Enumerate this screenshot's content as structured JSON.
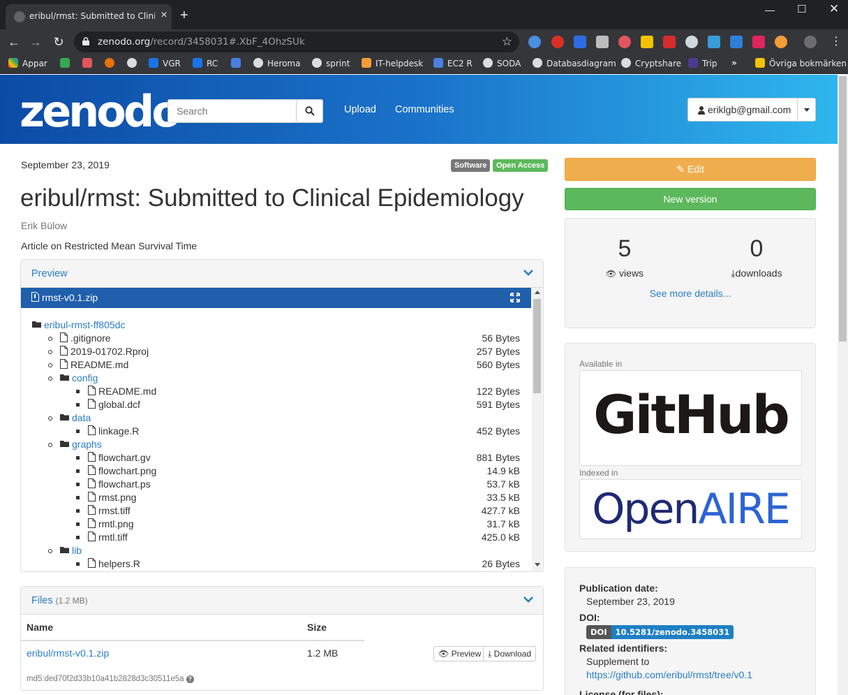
{
  "browser": {
    "tab_title": "eribul/rmst: Submitted to Clinical",
    "url_host": "zenodo.org",
    "url_path": "/record/3458031#.XbF_4OhzSUk",
    "bookmarks": [
      "Appar",
      "VGR",
      "RC",
      "Heroma",
      "sprint",
      "IT-helpdesk",
      "EC2 R",
      "SODA",
      "Databasdiagram",
      "Cryptshare",
      "Trip",
      "Övriga bokmärken"
    ]
  },
  "header": {
    "logo": "zenodo",
    "search_placeholder": "Search",
    "nav": [
      "Upload",
      "Communities"
    ],
    "user": "eriklgb@gmail.com"
  },
  "record": {
    "date": "September 23, 2019",
    "labels": [
      {
        "text": "Software",
        "color": "#777777"
      },
      {
        "text": "Open Access",
        "color": "#5cb85c"
      }
    ],
    "title": "eribul/rmst: Submitted to Clinical Epidemiology",
    "author": "Erik Bülow",
    "description": "Article on Restricted Mean Survival Time"
  },
  "preview": {
    "heading": "Preview",
    "file": "rmst-v0.1.zip",
    "tree": [
      {
        "level": 0,
        "type": "dir",
        "name": "eribul-rmst-ff805dc",
        "size": ""
      },
      {
        "level": 1,
        "type": "file",
        "name": ".gitignore",
        "size": "56 Bytes"
      },
      {
        "level": 1,
        "type": "file",
        "name": "2019-01702.Rproj",
        "size": "257 Bytes"
      },
      {
        "level": 1,
        "type": "file",
        "name": "README.md",
        "size": "560 Bytes"
      },
      {
        "level": 1,
        "type": "dir",
        "name": "config",
        "size": ""
      },
      {
        "level": 2,
        "type": "file",
        "name": "README.md",
        "size": "122 Bytes"
      },
      {
        "level": 2,
        "type": "file",
        "name": "global.dcf",
        "size": "591 Bytes"
      },
      {
        "level": 1,
        "type": "dir",
        "name": "data",
        "size": ""
      },
      {
        "level": 2,
        "type": "file",
        "name": "linkage.R",
        "size": "452 Bytes"
      },
      {
        "level": 1,
        "type": "dir",
        "name": "graphs",
        "size": ""
      },
      {
        "level": 2,
        "type": "file",
        "name": "flowchart.gv",
        "size": "881 Bytes"
      },
      {
        "level": 2,
        "type": "file",
        "name": "flowchart.png",
        "size": "14.9 kB"
      },
      {
        "level": 2,
        "type": "file",
        "name": "flowchart.ps",
        "size": "53.7 kB"
      },
      {
        "level": 2,
        "type": "file",
        "name": "rmst.png",
        "size": "33.5 kB"
      },
      {
        "level": 2,
        "type": "file",
        "name": "rmst.tiff",
        "size": "427.7 kB"
      },
      {
        "level": 2,
        "type": "file",
        "name": "rmtl.png",
        "size": "31.7 kB"
      },
      {
        "level": 2,
        "type": "file",
        "name": "rmtl.tiff",
        "size": "425.0 kB"
      },
      {
        "level": 1,
        "type": "dir",
        "name": "lib",
        "size": ""
      },
      {
        "level": 2,
        "type": "file",
        "name": "helpers.R",
        "size": "26 Bytes"
      }
    ]
  },
  "files": {
    "heading": "Files",
    "total": "(1.2 MB)",
    "col_name": "Name",
    "col_size": "Size",
    "row_name": "eribul/rmst-v0.1.zip",
    "row_size": "1.2 MB",
    "preview_btn": "Preview",
    "download_btn": "Download",
    "md5": "md5:ded70f2d33b10a41b2828d3c30511e5a"
  },
  "sidebar": {
    "edit_btn": "Edit",
    "new_version_btn": "New version",
    "views": "5",
    "views_label": "views",
    "downloads": "0",
    "downloads_label": "downloads",
    "see_more": "See more details...",
    "available_in": "Available in",
    "github": "GitHub",
    "indexed_in": "Indexed in",
    "openaire_open": "Open",
    "openaire_aire": "AIRE",
    "pub_date_label": "Publication date:",
    "pub_date": "September 23, 2019",
    "doi_label": "DOI:",
    "doi_tag": "DOI",
    "doi": "10.5281/zenodo.3458031",
    "related_label": "Related identifiers:",
    "supplement": "Supplement to",
    "related_url": "https://github.com/eribul/rmst/tree/v0.1",
    "license_label": "License (for files):"
  }
}
